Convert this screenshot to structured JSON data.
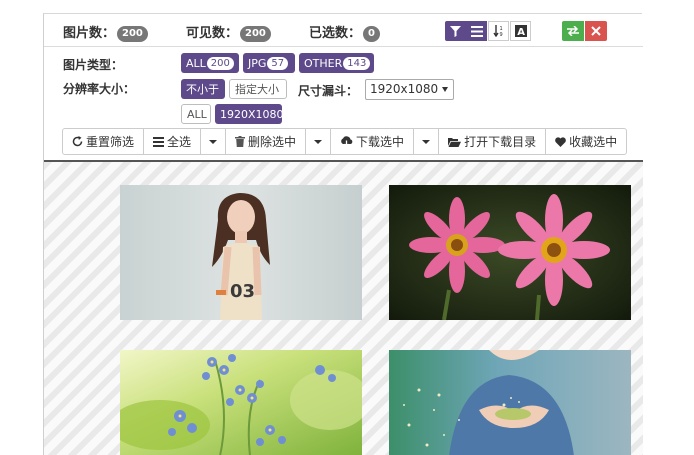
{
  "stats": {
    "total_label": "图片数：",
    "total_value": "200",
    "visible_label": "可见数：",
    "visible_value": "200",
    "selected_label": "已选数：",
    "selected_value": "0"
  },
  "top_icons": [
    "filter-icon",
    "list-icon",
    "sort-icon",
    "font-icon",
    "swap-icon",
    "close-icon"
  ],
  "filters": {
    "type_label": "图片类型：",
    "type_tags": [
      {
        "name": "ALL",
        "count": "200"
      },
      {
        "name": "JPG",
        "count": "57"
      },
      {
        "name": "OTHER",
        "count": "143"
      }
    ],
    "resolution_label": "分辨率大小：",
    "mode_active": "不小于",
    "mode_other": "指定大小",
    "funnel_label": "尺寸漏斗：",
    "funnel_value": "1920x1080",
    "res_all": "ALL",
    "res_value": "1920X1080"
  },
  "toolbar": {
    "reset": "重置筛选",
    "select_all": "全选",
    "delete": "删除选中",
    "download": "下载选中",
    "open_dir": "打开下载目录",
    "favorite": "收藏选中"
  },
  "colors": {
    "accent": "#5e4a8b",
    "badge": "#777777",
    "green": "#4cae4c",
    "red": "#d9534f"
  }
}
